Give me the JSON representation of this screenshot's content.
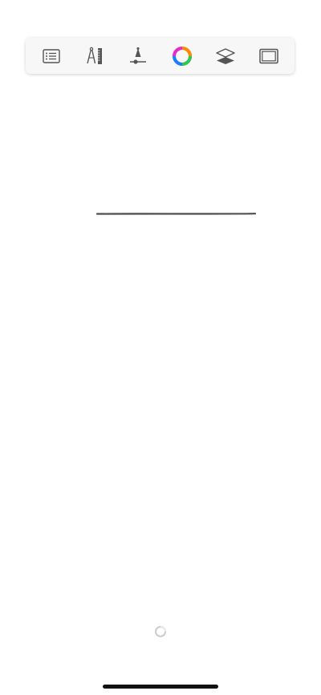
{
  "toolbar": {
    "tools": [
      {
        "name": "list-icon"
      },
      {
        "name": "ruler-compass-icon"
      },
      {
        "name": "brush-size-icon"
      },
      {
        "name": "color-wheel-icon"
      },
      {
        "name": "layers-icon"
      },
      {
        "name": "canvas-frame-icon"
      }
    ]
  },
  "canvas": {
    "stroke_color": "#3a3a3a"
  },
  "status": {
    "loading": true
  },
  "colors": {
    "toolbar_bg": "#f7f7f7",
    "icon": "#555555",
    "home_indicator": "#111111"
  }
}
